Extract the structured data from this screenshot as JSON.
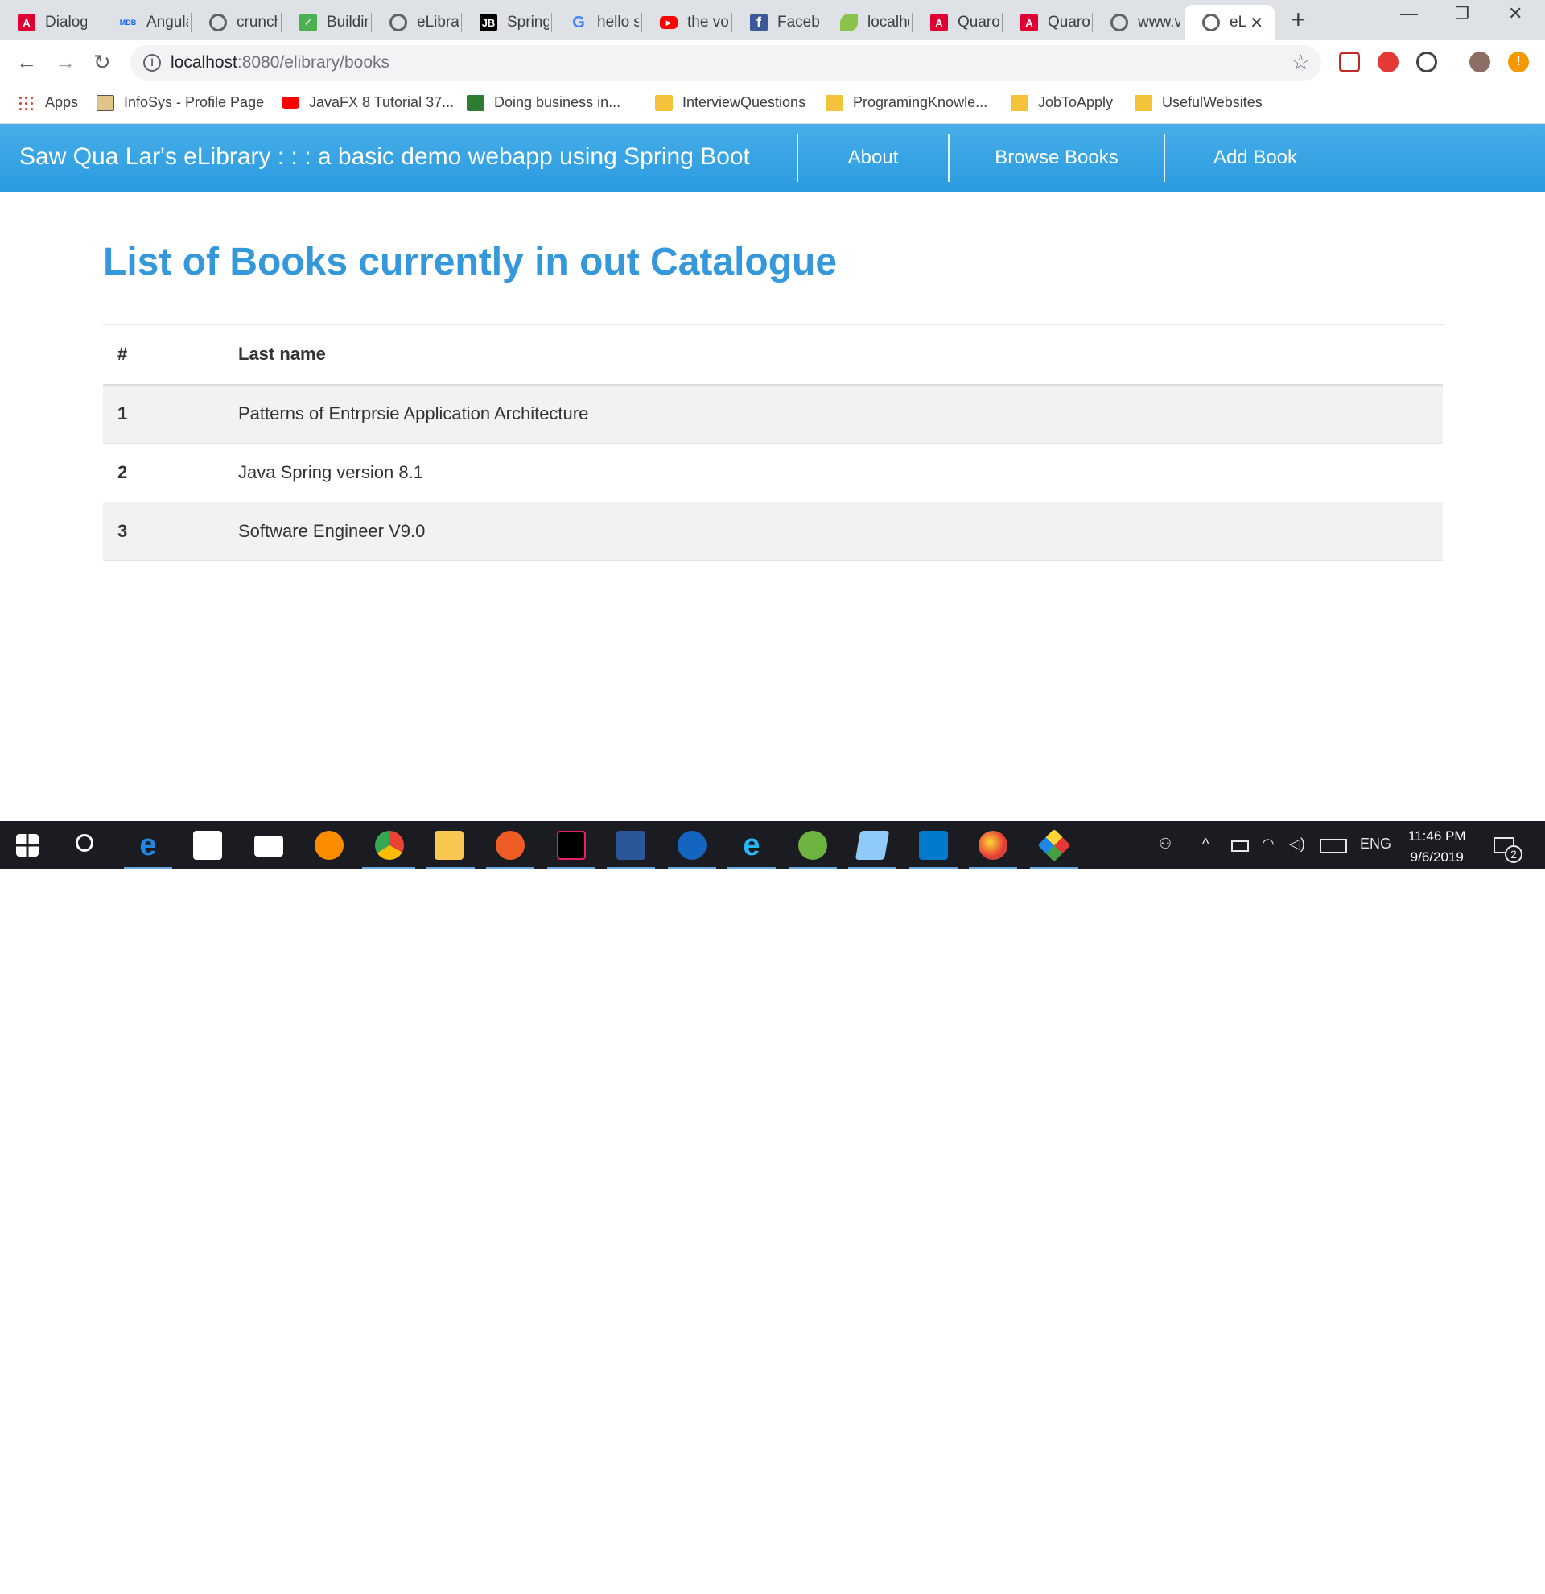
{
  "browser": {
    "tabs": [
      {
        "title": "Dialog",
        "icon": "angular-icon",
        "color": "#dd0031"
      },
      {
        "title": "Angula",
        "icon": "mdb-icon",
        "color": "#1266f1"
      },
      {
        "title": "crunch",
        "icon": "globe-icon",
        "color": "#5f6368"
      },
      {
        "title": "Buildin",
        "icon": "document-icon",
        "color": "#4caf50"
      },
      {
        "title": "eLibrar",
        "icon": "globe-icon",
        "color": "#5f6368"
      },
      {
        "title": "Spring",
        "icon": "jetbrains-icon",
        "color": "#000000"
      },
      {
        "title": "hello s",
        "icon": "google-icon",
        "color": "#4285f4"
      },
      {
        "title": "the vo",
        "icon": "youtube-icon",
        "color": "#ff0000"
      },
      {
        "title": "Facebo",
        "icon": "facebook-icon",
        "color": "#3b5998"
      },
      {
        "title": "localho",
        "icon": "spring-leaf-icon",
        "color": "#8bc34a"
      },
      {
        "title": "Quaro",
        "icon": "angular-icon",
        "color": "#dd0031"
      },
      {
        "title": "Quaro",
        "icon": "angular-icon",
        "color": "#dd0031"
      },
      {
        "title": "www.v",
        "icon": "globe-icon",
        "color": "#5f6368"
      },
      {
        "title": "eLi",
        "icon": "globe-icon",
        "color": "#5f6368",
        "active": true
      }
    ],
    "url_host": "localhost",
    "url_path": ":8080/elibrary/books",
    "bookmarks": [
      {
        "label": "Apps",
        "icon": "apps-grid-icon"
      },
      {
        "label": "InfoSys - Profile Page",
        "icon": "infosys-icon"
      },
      {
        "label": "JavaFX 8 Tutorial 37...",
        "icon": "youtube-icon"
      },
      {
        "label": "Doing business in...",
        "icon": "star-icon"
      },
      {
        "label": "InterviewQuestions",
        "icon": "folder-icon"
      },
      {
        "label": "ProgramingKnowle...",
        "icon": "folder-icon"
      },
      {
        "label": "JobToApply",
        "icon": "folder-icon"
      },
      {
        "label": "UsefulWebsites",
        "icon": "folder-icon"
      }
    ]
  },
  "navbar": {
    "brand": "Saw Qua Lar's eLibrary : : : a basic demo webapp using Spring Boot",
    "links": [
      "About",
      "Browse Books",
      "Add Book"
    ],
    "color": "#2a9be0"
  },
  "main": {
    "heading": "List of Books currently in out Catalogue",
    "heading_color": "#3498db",
    "table": {
      "headers": [
        "#",
        "Last name"
      ],
      "rows": [
        {
          "num": "1",
          "name": "Patterns of Entrprsie Application Architecture"
        },
        {
          "num": "2",
          "name": "Java Spring version 8.1"
        },
        {
          "num": "3",
          "name": "Software Engineer V9.0"
        }
      ]
    }
  },
  "taskbar": {
    "apps": [
      "windows-start-icon",
      "search-icon",
      "edge-icon",
      "store-icon",
      "mail-icon",
      "brave-icon",
      "chrome-icon",
      "file-explorer-icon",
      "postman-icon",
      "intellij-icon",
      "word-icon",
      "maps-icon",
      "ie-icon",
      "spring-tool-icon",
      "notepad-icon",
      "vscode-icon",
      "paint-icon",
      "gitkraken-icon"
    ],
    "lang": "ENG",
    "time": "11:46 PM",
    "date": "9/6/2019",
    "notification_count": "2"
  }
}
